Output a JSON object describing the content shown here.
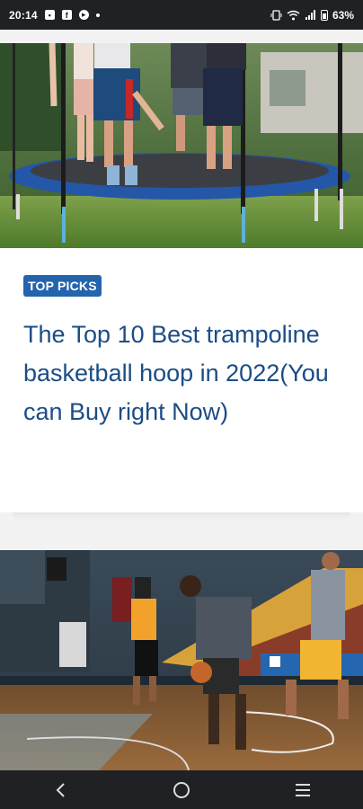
{
  "status_bar": {
    "time": "20:14",
    "battery": "63%"
  },
  "article": {
    "category": "TOP PICKS",
    "title": "The Top 10 Best trampoline basketball hoop in 2022(You can Buy right Now)"
  },
  "colors": {
    "badge_bg": "#2364ad",
    "title_text": "#1b4d85",
    "system_bars": "#202124"
  },
  "icons": {
    "status_left": [
      "message-icon",
      "facebook-icon",
      "media-icon"
    ],
    "status_right": [
      "vibrate-icon",
      "wifi-icon",
      "signal-icon",
      "battery-icon"
    ],
    "nav": [
      "back-icon",
      "home-icon",
      "recents-icon"
    ]
  }
}
